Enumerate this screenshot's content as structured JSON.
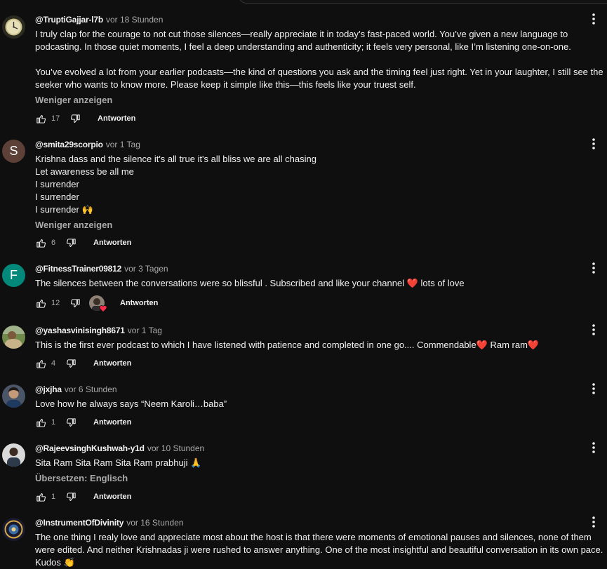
{
  "labels": {
    "reply": "Antworten",
    "show_less": "Weniger anzeigen",
    "translate": "Übersetzen: Englisch"
  },
  "comments": [
    {
      "author": "@TruptiGajjar-l7b",
      "time": "vor 18 Stunden",
      "text": "I truly clap for the courage to not cut those silences—really appreciate it in today’s fast-paced world. You’ve given a new language to podcasting. In those quiet moments, I feel a deep understanding and authenticity; it feels very personal, like I’m listening one-on-one.\n\nYou’ve evolved a lot from your earlier podcasts—the kind of questions you ask and the timing feel just right. Yet in your laughter, I still see the seeker who wants to know more. Please keep it simple like this—this feels like your truest self.",
      "likes": "17",
      "avatar_icon": "clock-avatar-icon"
    },
    {
      "author": "@smita29scorpio",
      "time": "vor 1 Tag",
      "text": "Krishna dass and the silence it's all true it's all bliss we are all chasing\nLet awareness be all me\nI surrender\nI surrender\nI surrender 🙌",
      "likes": "6",
      "avatar_letter": "S",
      "avatar_color": "#5d4037"
    },
    {
      "author": "@FitnessTrainer09812",
      "time": "vor 3 Tagen",
      "text": "The silences between the conversations were so blissful . Subscribed and like your channel ❤️  lots of love",
      "likes": "12",
      "avatar_letter": "F",
      "avatar_color": "#00897b",
      "creator_heart": true
    },
    {
      "author": "@yashasvinisingh8671",
      "time": "vor 1 Tag",
      "text": "This is the first ever podcast to which I have listened with patience and completed in one go.... Commendable❤️ Ram ram❤️",
      "likes": "4",
      "avatar_icon": "landscape-avatar-icon"
    },
    {
      "author": "@jxjha",
      "time": "vor 6 Stunden",
      "text": "Love how he always says “Neem Karoli…baba”",
      "likes": "1",
      "avatar_icon": "person-avatar-icon"
    },
    {
      "author": "@RajeevsinghKushwah-y1d",
      "time": "vor 10 Stunden",
      "text": "Sita Ram Sita Ram Sita Ram prabhuji 🙏",
      "likes": "1",
      "avatar_icon": "person-avatar-icon"
    },
    {
      "author": "@InstrumentOfDivinity",
      "time": "vor 16 Stunden",
      "text": "The one thing I realy love and appreciate most about the host is that there were moments of emotional pauses and silences, none of them were edited. And neither Krishnadas ji were rushed to answer anything. One of the most insightful and beautiful conversation in its own pace. Kudos 👏",
      "likes": "",
      "avatar_icon": "emblem-avatar-icon"
    }
  ]
}
